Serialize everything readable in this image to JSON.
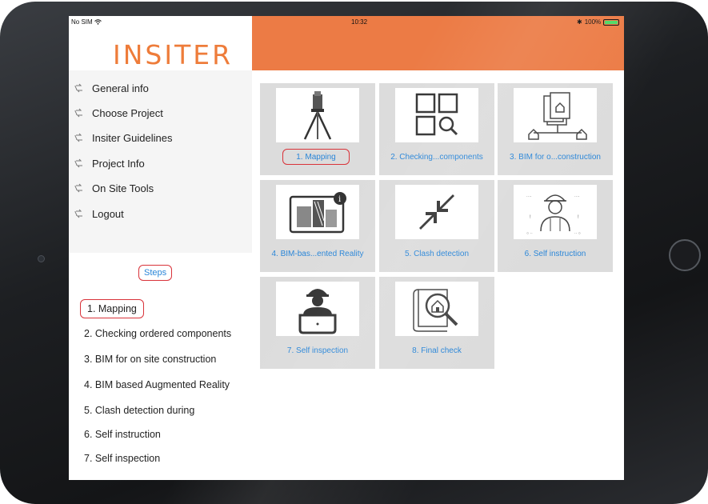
{
  "status_bar": {
    "carrier": "No SIM",
    "time": "10:32",
    "battery": "100%"
  },
  "logo": "INSITER",
  "menu": {
    "items": [
      {
        "label": "General info"
      },
      {
        "label": "Choose Project"
      },
      {
        "label": "Insiter Guidelines"
      },
      {
        "label": "Project Info"
      },
      {
        "label": "On Site Tools"
      },
      {
        "label": "Logout"
      }
    ]
  },
  "steps": {
    "header": "Steps",
    "items": [
      {
        "label": "1. Mapping"
      },
      {
        "label": "2. Checking ordered components"
      },
      {
        "label": "3. BIM for on site construction"
      },
      {
        "label": "4. BIM based Augmented Reality"
      },
      {
        "label": "5. Clash detection during"
      },
      {
        "label": "6. Self instruction"
      },
      {
        "label": "7. Self inspection"
      }
    ]
  },
  "tiles": [
    {
      "label": "1. Mapping",
      "icon": "tripod-scanner-icon"
    },
    {
      "label": "2. Checking...components",
      "icon": "grid-search-icon"
    },
    {
      "label": "3. BIM for o...construction",
      "icon": "building-plans-icon"
    },
    {
      "label": "4. BIM-bas...ented Reality",
      "icon": "augmented-reality-icon"
    },
    {
      "label": "5. Clash detection",
      "icon": "clash-arrows-icon"
    },
    {
      "label": "6. Self instruction",
      "icon": "worker-instruction-icon"
    },
    {
      "label": "7. Self inspection",
      "icon": "worker-laptop-icon"
    },
    {
      "label": "8. Final check",
      "icon": "house-magnifier-icon"
    }
  ],
  "colors": {
    "accent": "#ec7b45",
    "link": "#2a86d8",
    "highlight": "#d9333a"
  }
}
